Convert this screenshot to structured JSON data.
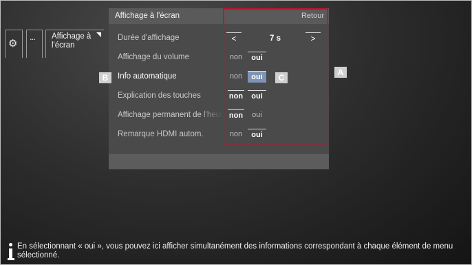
{
  "nav": {
    "settings_icon": "gear-icon",
    "more": "...",
    "current": "Affichage à l'écran"
  },
  "panel": {
    "title": "Affichage à l'écran",
    "back": "Retour",
    "rows": [
      {
        "label": "Durée d'affichage",
        "left_arrow": "<",
        "value": "7 s",
        "right_arrow": ">"
      },
      {
        "label": "Affichage du volume",
        "no": "non",
        "yes": "oui",
        "selected": "oui"
      },
      {
        "label": "Info automatique",
        "no": "non",
        "yes": "oui",
        "selected": "oui",
        "focused": true
      },
      {
        "label": "Explication des touches",
        "no": "non",
        "yes": "oui",
        "selected": "both"
      },
      {
        "label": "Affichage permanent de l'heure",
        "no": "non",
        "yes": "oui",
        "selected": "non"
      },
      {
        "label": "Remarque HDMI autom.",
        "no": "non",
        "yes": "oui",
        "selected": "oui"
      }
    ]
  },
  "callouts": {
    "a": "A",
    "b": "B",
    "c": "C"
  },
  "colors": {
    "highlight": "#7e94b5",
    "outline": "#c8102e",
    "panel": "#4a4a4a"
  },
  "info": {
    "icon": "info-icon",
    "text": "En sélectionnant « oui », vous pouvez ici afficher simultanément des informations correspondant à chaque élément de menu sélectionné."
  }
}
